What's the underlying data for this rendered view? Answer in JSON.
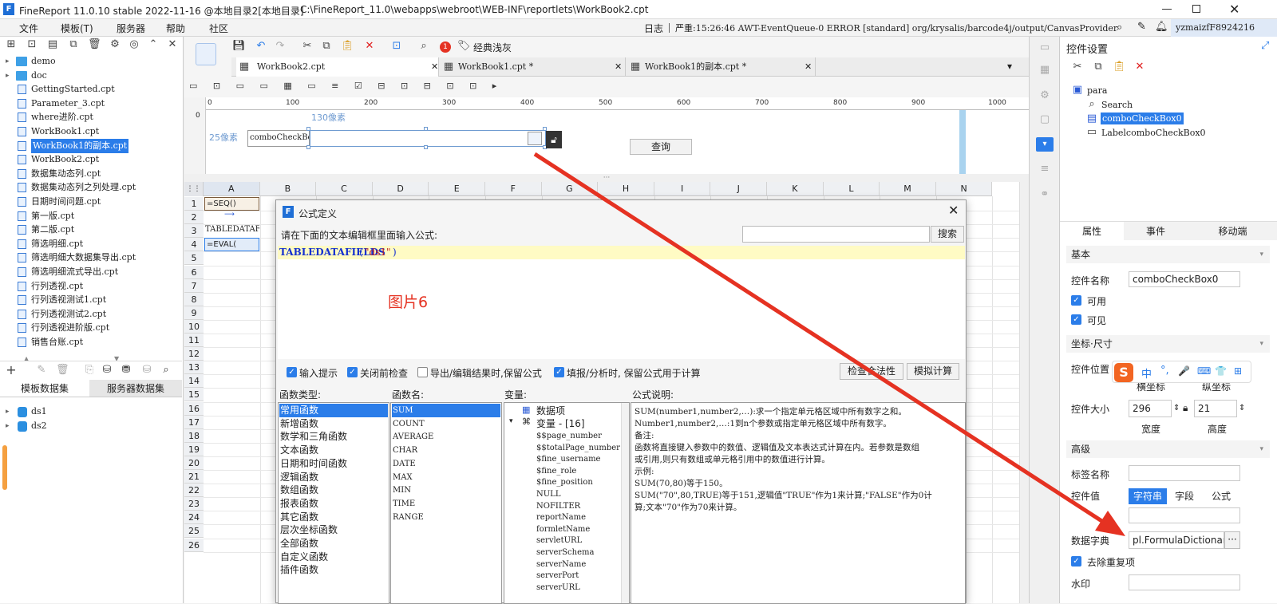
{
  "window": {
    "title": "FineReport 11.0.10 stable 2022-11-16 @本地目录2[本地目录]",
    "path": "C:\\FineReport_11.0\\webapps\\webroot\\WEB-INF\\reportlets\\WorkBook2.cpt"
  },
  "menu": {
    "items": [
      "文件",
      "模板(T)",
      "服务器",
      "帮助",
      "社区"
    ],
    "log_label": "日志",
    "log_message": "严重:15:26:46 AWT-EventQueue-0 ERROR [standard] org/krysalis/barcode4j/output/CanvasProvider",
    "username": "yzmaizfF8924216"
  },
  "file_tree": {
    "items": [
      {
        "label": "demo",
        "type": "folder"
      },
      {
        "label": "doc",
        "type": "folder"
      },
      {
        "label": "GettingStarted.cpt",
        "type": "file"
      },
      {
        "label": "Parameter_3.cpt",
        "type": "file"
      },
      {
        "label": "where进阶.cpt",
        "type": "file"
      },
      {
        "label": "WorkBook1.cpt",
        "type": "file"
      },
      {
        "label": "WorkBook1的副本.cpt",
        "type": "file",
        "selected": true
      },
      {
        "label": "WorkBook2.cpt",
        "type": "file"
      },
      {
        "label": "数据集动态列.cpt",
        "type": "file"
      },
      {
        "label": "数据集动态列之列处理.cpt",
        "type": "file"
      },
      {
        "label": "日期时间问题.cpt",
        "type": "file"
      },
      {
        "label": "第一版.cpt",
        "type": "file"
      },
      {
        "label": "第二版.cpt",
        "type": "file"
      },
      {
        "label": "筛选明细.cpt",
        "type": "file"
      },
      {
        "label": "筛选明细大数据集导出.cpt",
        "type": "file"
      },
      {
        "label": "筛选明细流式导出.cpt",
        "type": "file"
      },
      {
        "label": "行列透视.cpt",
        "type": "file"
      },
      {
        "label": "行列透视测试1.cpt",
        "type": "file"
      },
      {
        "label": "行列透视测试2.cpt",
        "type": "file"
      },
      {
        "label": "行列透视进阶版.cpt",
        "type": "file"
      },
      {
        "label": "销售台账.cpt",
        "type": "file"
      }
    ]
  },
  "dataset_tabs": {
    "template": "模板数据集",
    "server": "服务器数据集"
  },
  "datasets": [
    "ds1",
    "ds2"
  ],
  "toolbar": {
    "style_label": "经典浅灰"
  },
  "doc_tabs": [
    "WorkBook2.cpt",
    "WorkBook1.cpt *",
    "WorkBook1的副本.cpt *"
  ],
  "ruler": [
    "0",
    "100",
    "200",
    "300",
    "400",
    "500",
    "600",
    "700",
    "800",
    "900",
    "1000"
  ],
  "param_pane": {
    "width_hint": "130像素",
    "height_hint": "25像素",
    "combo_label": "comboCheckBo:",
    "query_button": "查询"
  },
  "sheet": {
    "columns": [
      "A",
      "B",
      "C",
      "D",
      "E",
      "F",
      "G",
      "H",
      "I",
      "J",
      "K",
      "L",
      "M",
      "N"
    ],
    "rows": [
      "1",
      "2",
      "3",
      "4",
      "5",
      "6",
      "7",
      "8",
      "9",
      "10",
      "11",
      "12",
      "13",
      "14",
      "15",
      "16",
      "17",
      "18",
      "19",
      "20",
      "21",
      "22",
      "23",
      "24",
      "25",
      "26"
    ],
    "cells": {
      "a1": "=SEQ()",
      "a2": "TABLEDATAFI",
      "a3": "=EVAL("
    }
  },
  "dialog": {
    "title": "公式定义",
    "prompt": "请在下面的文本编辑框里面输入公式:",
    "search_button": "搜索",
    "formula_fn": "TABLEDATAFIELDS",
    "formula_arg": "\"ds1\"",
    "annotation": "图片6",
    "options": [
      {
        "label": "输入提示",
        "checked": true
      },
      {
        "label": "关闭前检查",
        "checked": true
      },
      {
        "label": "导出/编辑结果时,保留公式",
        "checked": false
      },
      {
        "label": "填报/分析时, 保留公式用于计算",
        "checked": true
      }
    ],
    "check_button": "检查合法性",
    "simulate_button": "模拟计算",
    "headers": {
      "category": "函数类型:",
      "function": "函数名:",
      "variable": "变量:",
      "description": "公式说明:"
    },
    "categories": [
      "常用函数",
      "新增函数",
      "数学和三角函数",
      "文本函数",
      "日期和时间函数",
      "逻辑函数",
      "数组函数",
      "报表函数",
      "其它函数",
      "层次坐标函数",
      "全部函数",
      "自定义函数",
      "插件函数"
    ],
    "functions": [
      "SUM",
      "COUNT",
      "AVERAGE",
      "CHAR",
      "DATE",
      "MAX",
      "MIN",
      "TIME",
      "RANGE"
    ],
    "variables": {
      "data_item": "数据项",
      "group": "变量 - [16]",
      "items": [
        "$$page_number",
        "$$totalPage_number",
        "$fine_username",
        "$fine_role",
        "$fine_position",
        "NULL",
        "NOFILTER",
        "reportName",
        "formletName",
        "servletURL",
        "serverSchema",
        "serverName",
        "serverPort",
        "serverURL"
      ]
    },
    "description_lines": [
      "SUM(number1,number2,…):求一个指定单元格区域中所有数字之和。",
      "Number1,number2,…:1到n个参数或指定单元格区域中所有数字。",
      "备注:",
      "函数将直接键入参数中的数值、逻辑值及文本表达式计算在内。若参数是数组",
      "或引用,则只有数组或单元格引用中的数值进行计算。",
      "示例:",
      "SUM(70,80)等于150。",
      "SUM(\"70\",80,TRUE)等于151,逻辑值\"TRUE\"作为1来计算;\"FALSE\"作为0计",
      "算;文本\"70\"作为70来计算。"
    ]
  },
  "right_panel": {
    "title": "控件设置",
    "tree": {
      "root": "para",
      "children": [
        "Search",
        "comboCheckBox0",
        "LabelcomboCheckBox0"
      ]
    },
    "tabs": [
      "属性",
      "事件",
      "移动端"
    ],
    "basic": {
      "section": "基本",
      "name_label": "控件名称",
      "name_value": "comboCheckBox0",
      "enabled_label": "可用",
      "visible_label": "可见"
    },
    "position": {
      "section": "坐标·尺寸",
      "pos_label": "控件位置",
      "x_label": "横坐标",
      "y_label": "纵坐标",
      "size_label": "控件大小",
      "width_value": "296",
      "height_value": "21",
      "width_label": "宽度",
      "height_label": "高度"
    },
    "advanced": {
      "section": "高级",
      "tag_label": "标签名称",
      "value_label": "控件值",
      "value_tabs": [
        "字符串",
        "字段",
        "公式"
      ],
      "dict_label": "数据字典",
      "dict_value": "pl.FormulaDictionary",
      "dedupe_label": "去除重复项",
      "watermark_label": "水印"
    }
  },
  "ime": {
    "logo": "S",
    "items": [
      "中",
      "°,",
      "🎤",
      "⌨",
      "👕",
      "⊞"
    ]
  },
  "colors": {
    "accent": "#2b7de9",
    "arrow": "#e53222",
    "annotation": "#e53222"
  }
}
